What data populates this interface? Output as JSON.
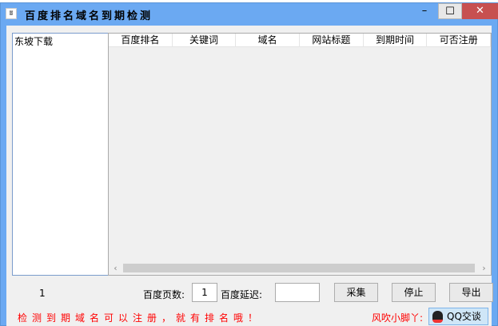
{
  "window": {
    "title": "百度排名域名到期检测",
    "min": "–",
    "max": "☐",
    "close": "✕"
  },
  "sidebar": {
    "items": [
      "东坡下载"
    ]
  },
  "table": {
    "columns": [
      "百度排名",
      "关键词",
      "域名",
      "网站标题",
      "到期时间",
      "可否注册"
    ]
  },
  "bottom": {
    "count": "1",
    "pages_label": "百度页数:",
    "pages_value": "1",
    "delay_label": "百度延迟:",
    "delay_value": "",
    "collect": "采集",
    "stop": "停止",
    "export": "导出"
  },
  "footer": {
    "notice": "检测到期域名可以注册，就有排名哦！",
    "author": "风吹小脚丫:",
    "qq": "QQ交谈"
  }
}
